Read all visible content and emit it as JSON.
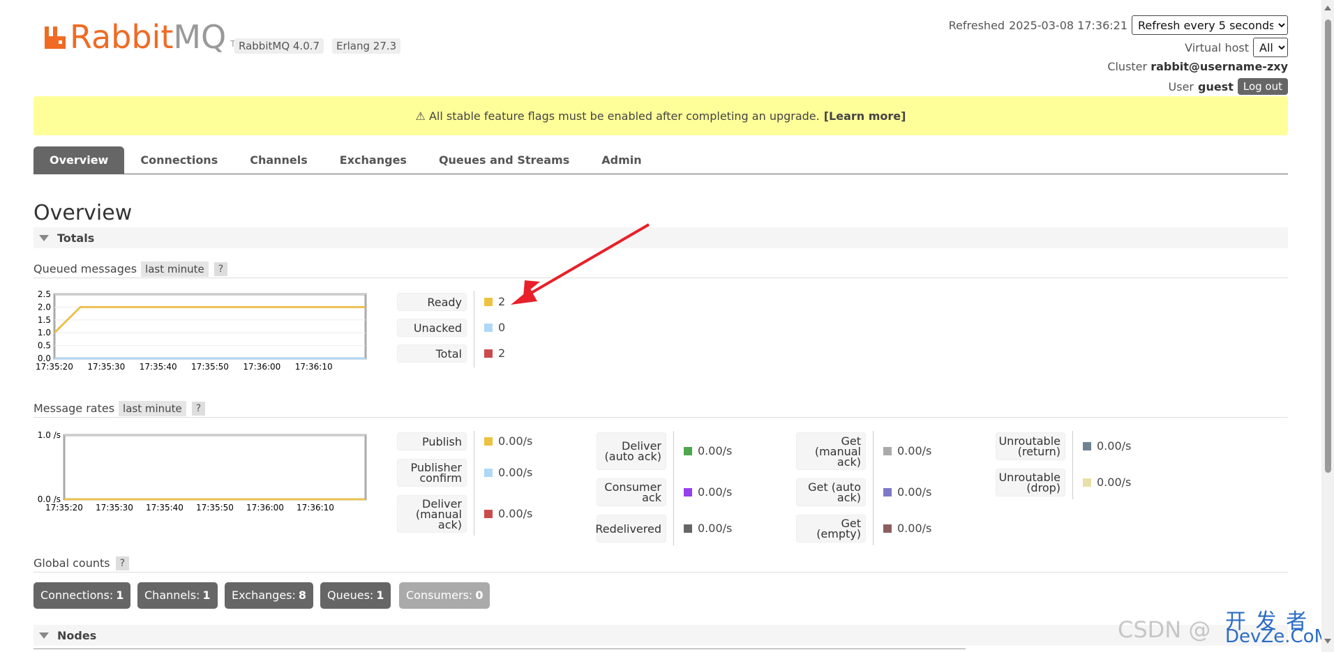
{
  "header": {
    "logo_brand": "Rabbit",
    "logo_mq": "MQ",
    "logo_tm": "TM",
    "version_chip": "RabbitMQ 4.0.7",
    "erlang_chip": "Erlang 27.3",
    "refreshed_label": "Refreshed",
    "refreshed_time": "2025-03-08 17:36:21",
    "refresh_select": "Refresh every 5 seconds",
    "vhost_label": "Virtual host",
    "vhost_value": "All",
    "cluster_label": "Cluster",
    "cluster_value": "rabbit@username-zxy",
    "user_label": "User",
    "user_value": "guest",
    "logout_label": "Log out"
  },
  "banner": {
    "text": "⚠ All stable feature flags must be enabled after completing an upgrade.",
    "link": "[Learn more]"
  },
  "tabs": [
    "Overview",
    "Connections",
    "Channels",
    "Exchanges",
    "Queues and Streams",
    "Admin"
  ],
  "page_title": "Overview",
  "totals_section": "Totals",
  "queued": {
    "heading": "Queued messages",
    "range_chip": "last minute",
    "help": "?",
    "stats": [
      {
        "label": "Ready",
        "value": "2",
        "color": "#edc240"
      },
      {
        "label": "Unacked",
        "value": "0",
        "color": "#afd8f8"
      },
      {
        "label": "Total",
        "value": "2",
        "color": "#cb4b4b"
      }
    ]
  },
  "rates": {
    "heading": "Message rates",
    "range_chip": "last minute",
    "help": "?",
    "col1": [
      {
        "label": "Publish",
        "value": "0.00/s",
        "color": "#edc240"
      },
      {
        "label": "Publisher confirm",
        "value": "0.00/s",
        "color": "#afd8f8"
      },
      {
        "label": "Deliver (manual ack)",
        "value": "0.00/s",
        "color": "#cb4b4b"
      }
    ],
    "col2": [
      {
        "label": "Deliver (auto ack)",
        "value": "0.00/s",
        "color": "#4da74d"
      },
      {
        "label": "Consumer ack",
        "value": "0.00/s",
        "color": "#9440ed"
      },
      {
        "label": "Redelivered",
        "value": "0.00/s",
        "color": "#666666"
      }
    ],
    "col3": [
      {
        "label": "Get (manual ack)",
        "value": "0.00/s",
        "color": "#aaaaaa"
      },
      {
        "label": "Get (auto ack)",
        "value": "0.00/s",
        "color": "#7c79c9"
      },
      {
        "label": "Get (empty)",
        "value": "0.00/s",
        "color": "#8c5e5e"
      }
    ],
    "col4": [
      {
        "label": "Unroutable (return)",
        "value": "0.00/s",
        "color": "#6e8394"
      },
      {
        "label": "Unroutable (drop)",
        "value": "0.00/s",
        "color": "#e8e0a8"
      }
    ]
  },
  "global": {
    "heading": "Global counts",
    "help": "?",
    "counts": [
      {
        "label": "Connections:",
        "value": "1"
      },
      {
        "label": "Channels:",
        "value": "1"
      },
      {
        "label": "Exchanges:",
        "value": "8"
      },
      {
        "label": "Queues:",
        "value": "1"
      },
      {
        "label": "Consumers:",
        "value": "0"
      }
    ]
  },
  "nodes_section": "Nodes",
  "watermark": {
    "csdn": "CSDN @",
    "site_top": "开 发 者",
    "site_bottom": "DevZe.CoM"
  },
  "chart_data": [
    {
      "type": "line",
      "x": [
        "17:35:20",
        "17:35:25",
        "17:35:30",
        "17:35:35",
        "17:35:40",
        "17:35:45",
        "17:35:50",
        "17:35:55",
        "17:36:00",
        "17:36:05",
        "17:36:10",
        "17:36:15",
        "17:36:20"
      ],
      "xticks": [
        "17:35:20",
        "17:35:30",
        "17:35:40",
        "17:35:50",
        "17:36:00",
        "17:36:10"
      ],
      "yticks": [
        "2.5",
        "2.0",
        "1.5",
        "1.0",
        "0.5",
        "0.0"
      ],
      "ylim": [
        0,
        2.5
      ],
      "series": [
        {
          "name": "Ready",
          "color": "#edc240",
          "values": [
            1,
            2,
            2,
            2,
            2,
            2,
            2,
            2,
            2,
            2,
            2,
            2,
            2
          ]
        },
        {
          "name": "Unacked",
          "color": "#afd8f8",
          "values": [
            0,
            0,
            0,
            0,
            0,
            0,
            0,
            0,
            0,
            0,
            0,
            0,
            0
          ]
        },
        {
          "name": "Total",
          "color": "#cb4b4b",
          "values": [
            1,
            2,
            2,
            2,
            2,
            2,
            2,
            2,
            2,
            2,
            2,
            2,
            2
          ]
        }
      ]
    },
    {
      "type": "line",
      "x": [
        "17:35:20",
        "17:35:25",
        "17:35:30",
        "17:35:35",
        "17:35:40",
        "17:35:45",
        "17:35:50",
        "17:35:55",
        "17:36:00",
        "17:36:05",
        "17:36:10",
        "17:36:15",
        "17:36:20"
      ],
      "xticks": [
        "17:35:20",
        "17:35:30",
        "17:35:40",
        "17:35:50",
        "17:36:00",
        "17:36:10"
      ],
      "yticks": [
        "1.0 /s",
        "0.0 /s"
      ],
      "ylim": [
        0,
        1
      ],
      "series": [
        {
          "name": "Publish",
          "color": "#edc240",
          "values": [
            0,
            0,
            0,
            0,
            0,
            0,
            0,
            0,
            0,
            0,
            0,
            0,
            0
          ]
        }
      ]
    }
  ]
}
